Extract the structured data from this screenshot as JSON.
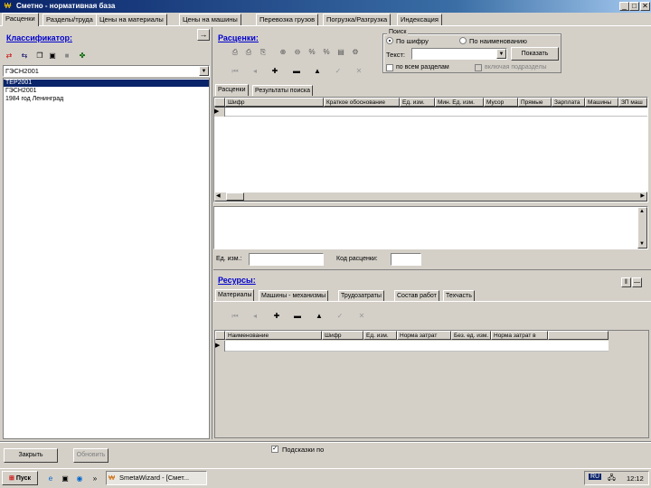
{
  "window": {
    "title": "Сметно - нормативная база",
    "controls": [
      "_",
      "□",
      "✕"
    ]
  },
  "tabs": [
    "Расценки",
    "Разделы/труда",
    "Цены на материалы",
    "Цены на машины",
    "Перевозка грузов",
    "Погрузка/Разгрузка",
    "Индексация"
  ],
  "classifier": {
    "heading": "Классификатор:",
    "expand": "→",
    "selected_value": "ГЭСН2001",
    "items": [
      "ТЕР2001",
      "ГЭСН2001",
      "1984 год Ленинград"
    ]
  },
  "prices": {
    "heading": "Расценки:",
    "subtabs": [
      "Расценки",
      "Результаты поиска"
    ],
    "columns": [
      "Шифр",
      "Краткое обоснование",
      "Ед. изм.",
      "Мин. Ед. изм.",
      "Мусор",
      "Прямые",
      "Зарплата",
      "Машины",
      "ЗП маш"
    ],
    "unit_label": "Ед. изм.:",
    "unit_value": "",
    "code_label": "Код расценки:",
    "code_value": ""
  },
  "search": {
    "title": "Поиск",
    "by_code": "По шифру",
    "by_name": "По наименованию",
    "text_label": "Текст:",
    "text_value": "",
    "button": "Показать",
    "all_sections": "по всем разделам",
    "include_subsections": "включая подразделы"
  },
  "resources": {
    "heading": "Ресурсы:",
    "subtabs": [
      "Материалы",
      "Машины - механизмы",
      "Трудозатраты",
      "Состав работ",
      "Техчасть"
    ],
    "columns": [
      "Наименование",
      "Шифр",
      "Ед. изм.",
      "Норма затрат",
      "Без. ед. изм.",
      "Норма затрат в"
    ]
  },
  "bottom": {
    "close_button": "Закрыть",
    "update_button": "Обновить",
    "checkbox_label": "Подсказки по"
  },
  "taskbar": {
    "start": "Пуск",
    "task": "SmetaWizard - [Смет...",
    "lang": "RU",
    "clock": "12:12"
  }
}
